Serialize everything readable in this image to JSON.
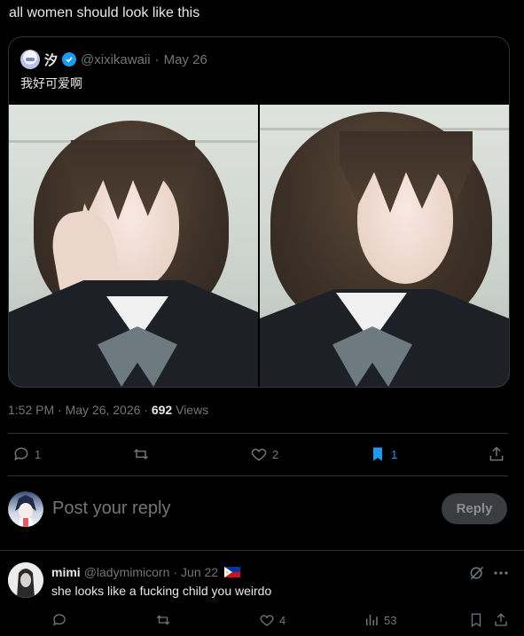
{
  "tweet": {
    "text": "all women should look like this"
  },
  "quoted": {
    "name": "汐",
    "handle": "@xixikawaii",
    "separator": "·",
    "date": "May 26",
    "text": "我好可爱啊"
  },
  "meta": {
    "time_date": "1:52 PM · May 26, 2026 ·",
    "views_count": "692",
    "views_label": "Views"
  },
  "actions": {
    "replies": "1",
    "likes": "2",
    "bookmarks": "1"
  },
  "compose": {
    "placeholder": "Post your reply",
    "reply_label": "Reply"
  },
  "comment": {
    "name": "mimi",
    "handle": "@ladymimicorn",
    "separator": "·",
    "date": "Jun 22",
    "text": "she looks like a fucking child you weirdo",
    "likes": "4",
    "views": "53"
  },
  "colors": {
    "background": "#000000",
    "text": "#e7e9ea",
    "muted": "#71767b",
    "accent": "#1d9bf0",
    "border": "#2f3336"
  },
  "icons": [
    "verified-badge-icon",
    "reply-icon",
    "retweet-icon",
    "like-icon",
    "bookmark-icon",
    "share-icon",
    "grok-icon",
    "more-icon",
    "views-icon",
    "flag-ph-icon"
  ]
}
